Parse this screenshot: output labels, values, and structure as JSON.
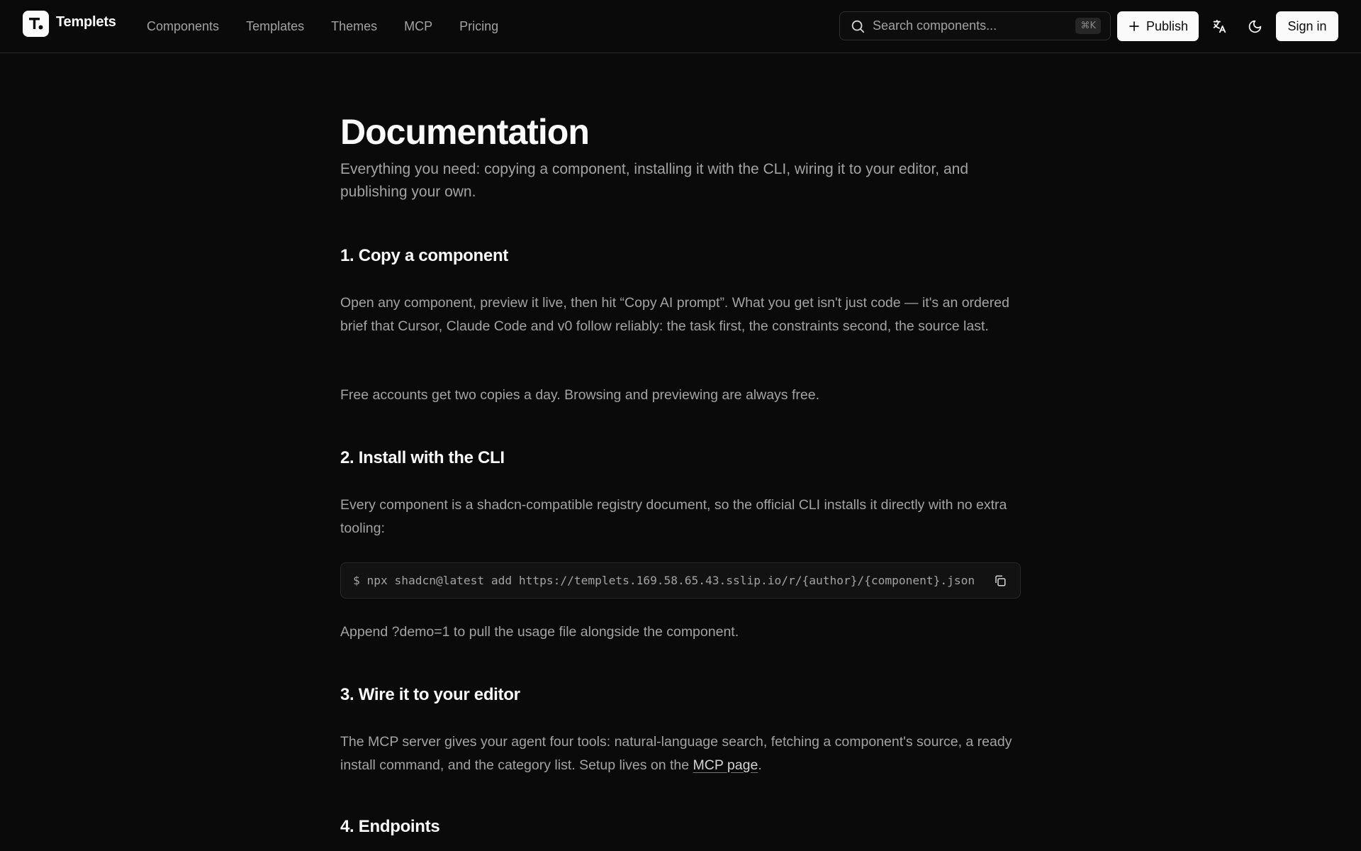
{
  "header": {
    "brand": "Templets",
    "nav": [
      "Components",
      "Templates",
      "Themes",
      "MCP",
      "Pricing"
    ],
    "search_placeholder": "Search components...",
    "search_shortcut": "⌘K",
    "publish_label": "Publish",
    "signin_label": "Sign in",
    "icons": {
      "search": "search-icon",
      "plus": "plus-icon",
      "translate": "translate-icon",
      "theme": "moon-icon",
      "copy": "copy-icon"
    }
  },
  "doc": {
    "title": "Documentation",
    "subtitle": "Everything you need: copying a component, installing it with the CLI, wiring it to your editor, and publishing your own.",
    "sections": [
      {
        "heading": "1. Copy a component",
        "paragraphs": [
          "Open any component, preview it live, then hit “Copy AI prompt”. What you get isn't just code — it's an ordered brief that Cursor, Claude Code and v0 follow reliably: the task first, the constraints second, the source last.",
          "Free accounts get two copies a day. Browsing and previewing are always free."
        ]
      },
      {
        "heading": "2. Install with the CLI",
        "paragraphs": [
          "Every component is a shadcn-compatible registry document, so the official CLI installs it directly with no extra tooling:",
          "Append ?demo=1 to pull the usage file alongside the component."
        ],
        "code": "$ npx shadcn@latest add https://templets.169.58.65.43.sslip.io/r/{author}/{component}.json"
      },
      {
        "heading": "3. Wire it to your editor",
        "paragraph_prefix": "The MCP server gives your agent four tools: natural-language search, fetching a component's source, a ready install command, and the category list. Setup lives on the ",
        "link_text": "MCP page",
        "paragraph_suffix": "."
      },
      {
        "heading": "4. Endpoints"
      }
    ]
  },
  "colors": {
    "background": "#0a0a0a",
    "text_primary": "#fafafa",
    "text_muted": "#a3a3a3",
    "border": "#262626"
  }
}
